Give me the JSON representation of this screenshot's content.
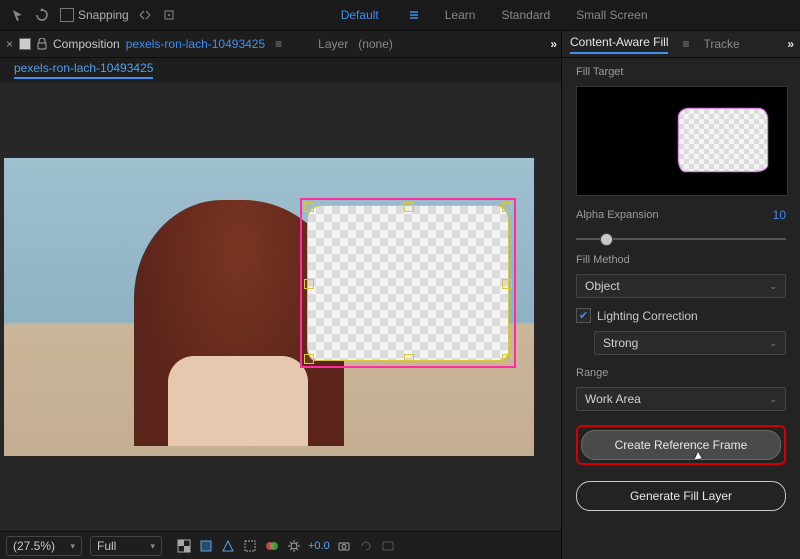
{
  "topbar": {
    "snapping_label": "Snapping"
  },
  "workspaces": {
    "default": "Default",
    "learn": "Learn",
    "standard": "Standard",
    "small_screen": "Small Screen"
  },
  "composition": {
    "panel_label": "Composition",
    "name": "pexels-ron-lach-10493425",
    "layer_panel_label": "Layer",
    "layer_none": "(none)",
    "subtab_name": "pexels-ron-lach-10493425"
  },
  "viewer_footer": {
    "zoom": "(27.5%)",
    "resolution": "Full",
    "exposure": "+0.0"
  },
  "right_panel": {
    "tab_caf": "Content-Aware Fill",
    "tab_tracker": "Tracke",
    "fill_target_label": "Fill Target",
    "alpha_expansion_label": "Alpha Expansion",
    "alpha_expansion_value": "10",
    "fill_method_label": "Fill Method",
    "fill_method_value": "Object",
    "lighting_correction_label": "Lighting Correction",
    "lighting_correction_checked": true,
    "lighting_strength_value": "Strong",
    "range_label": "Range",
    "range_value": "Work Area",
    "btn_create_reference": "Create Reference Frame",
    "btn_generate_fill": "Generate Fill Layer"
  }
}
